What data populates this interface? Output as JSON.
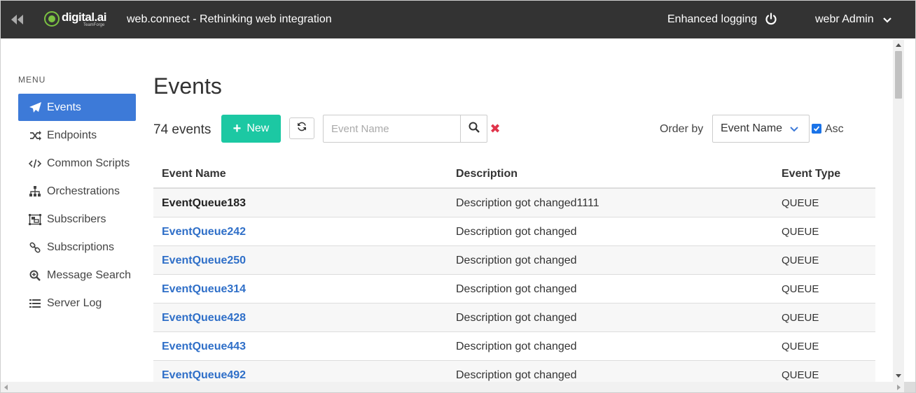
{
  "topbar": {
    "back_icon": "double-chevron-left-icon",
    "logo_text": "digital.ai",
    "logo_sub": "TeamForge",
    "app_title": "web.connect - Rethinking web integration",
    "enhanced_logging": "Enhanced logging",
    "power_icon": "power-icon",
    "user": "webr Admin",
    "user_chevron_icon": "chevron-down-icon"
  },
  "sidebar": {
    "menu_label": "MENU",
    "items": [
      {
        "label": "Events",
        "icon": "paper-plane-icon",
        "active": true
      },
      {
        "label": "Endpoints",
        "icon": "random-icon",
        "active": false
      },
      {
        "label": "Common Scripts",
        "icon": "code-icon",
        "active": false
      },
      {
        "label": "Orchestrations",
        "icon": "sitemap-icon",
        "active": false
      },
      {
        "label": "Subscribers",
        "icon": "object-group-icon",
        "active": false
      },
      {
        "label": "Subscriptions",
        "icon": "link-icon",
        "active": false
      },
      {
        "label": "Message Search",
        "icon": "search-plus-icon",
        "active": false
      },
      {
        "label": "Server Log",
        "icon": "list-icon",
        "active": false
      }
    ]
  },
  "main": {
    "title": "Events",
    "count_num": "74",
    "count_label": "events",
    "new_button": "New",
    "search_placeholder": "Event Name",
    "order_by_label": "Order by",
    "order_by_value": "Event Name",
    "asc_label": "Asc",
    "asc_checked": true
  },
  "table": {
    "headers": [
      "Event Name",
      "Description",
      "Event Type"
    ],
    "rows": [
      {
        "name": "EventQueue183",
        "description": "Description got changed1111",
        "type": "QUEUE"
      },
      {
        "name": "EventQueue242",
        "description": "Description got changed",
        "type": "QUEUE"
      },
      {
        "name": "EventQueue250",
        "description": "Description got changed",
        "type": "QUEUE"
      },
      {
        "name": "EventQueue314",
        "description": "Description got changed",
        "type": "QUEUE"
      },
      {
        "name": "EventQueue428",
        "description": "Description got changed",
        "type": "QUEUE"
      },
      {
        "name": "EventQueue443",
        "description": "Description got changed",
        "type": "QUEUE"
      },
      {
        "name": "EventQueue492",
        "description": "Description got changed",
        "type": "QUEUE"
      }
    ]
  },
  "colors": {
    "topbar": "#333333",
    "active_nav": "#3d7ad8",
    "new_button": "#1cc8a3",
    "link": "#2f6fc8",
    "clear": "#e0344b"
  }
}
